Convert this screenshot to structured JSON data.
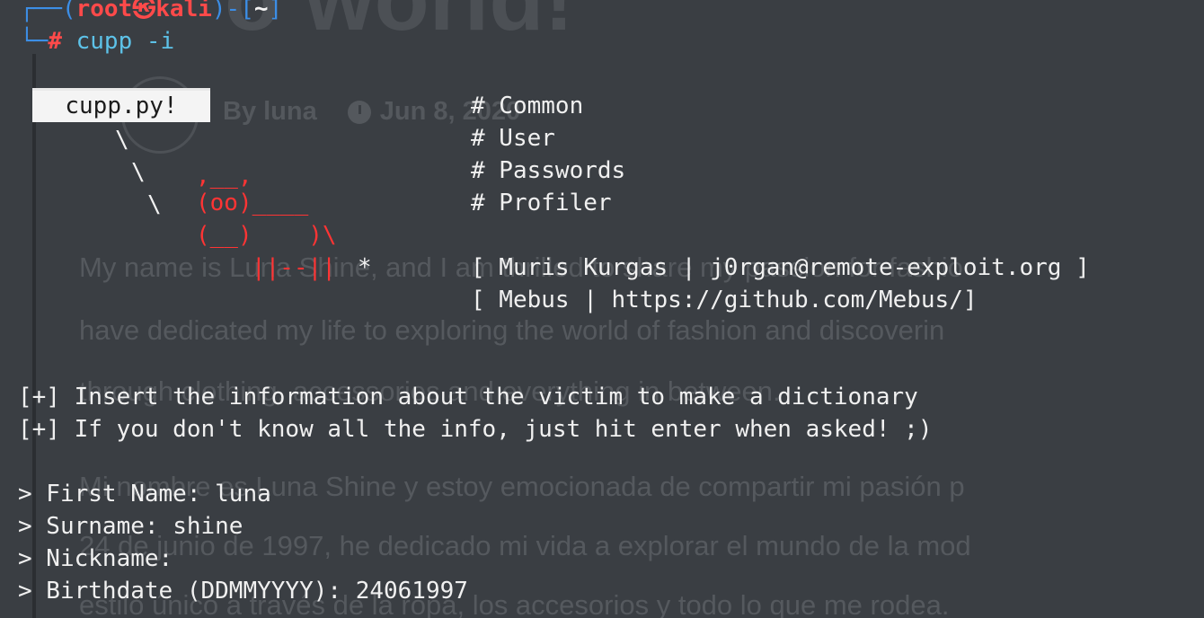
{
  "background_page": {
    "title_fragment": "o world!",
    "author": "By luna",
    "date": "Jun 8, 2020",
    "paragraphs": [
      "My name is Luna Shine, and I am thrilled to share my passion for fashio",
      "have dedicated my life to exploring the world of fashion and discoverin",
      "through clothing, accessories and everything in between.",
      "Mi nombre es Luna Shine y estoy emocionada de compartir mi pasión p",
      "24 de junio de 1997, he dedicado mi vida a explorar el mundo de la mod",
      "estilo único a través de la ropa, los accesorios y todo lo que me rodea."
    ]
  },
  "terminal": {
    "prompt": {
      "open": "┌──(",
      "user": "root",
      "at": "㉿",
      "host": "kali",
      "mid": ")-[",
      "path": "~",
      "close": "]",
      "corner": "└─",
      "symbol": "#",
      "command": "cupp",
      "flag": "-i"
    },
    "logo": {
      "label": "cupp.py!",
      "slash1": "\\",
      "slash2": "\\",
      "slash3": "\\",
      "cow_top": ",__,",
      "cow_eyes": "(oo)____",
      "cow_mid": "(__)    )\\",
      "cow_legs": "||--|| ",
      "star": "*"
    },
    "menu": [
      "# Common",
      "# User",
      "# Passwords",
      "# Profiler"
    ],
    "credits": [
      "[ Muris Kurgas | j0rgan@remote-exploit.org ]",
      "[ Mebus | https://github.com/Mebus/]"
    ],
    "info": [
      "[+] Insert the information about the victim to make a dictionary",
      "[+] If you don't know all the info, just hit enter when asked! ;)"
    ],
    "fields": [
      {
        "label": "> First Name: ",
        "value": "luna"
      },
      {
        "label": "> Surname: ",
        "value": "shine"
      },
      {
        "label": "> Nickname: ",
        "value": ""
      },
      {
        "label": "> Birthdate (DDMMYYYY): ",
        "value": "24061997"
      }
    ]
  },
  "colors": {
    "background": "#3a3e43",
    "prompt_user": "#ff4a4a",
    "prompt_frame": "#2f7fd6",
    "command": "#5dc2e8",
    "ascii_cow": "#ff3434",
    "text": "#f0f0f0"
  }
}
